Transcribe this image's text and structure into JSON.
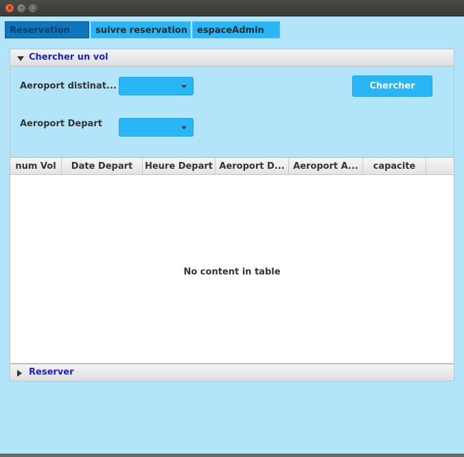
{
  "window": {
    "close_glyph": "×",
    "min_glyph": "–",
    "max_glyph": "□"
  },
  "tabs": [
    {
      "label": "Reservation",
      "active": true
    },
    {
      "label": "suivre reservation",
      "active": false
    },
    {
      "label": "espaceAdmin",
      "active": false
    }
  ],
  "search_pane": {
    "title": "Chercher un vol",
    "expanded": true,
    "destination_label": "Aeroport distinat...",
    "departure_label": "Aeroport Depart",
    "destination_value": "",
    "departure_value": "",
    "search_button": "Chercher"
  },
  "table": {
    "columns": [
      "num Vol",
      "Date Depart",
      "Heure Depart",
      "Aeroport D...",
      "Aeroport A...",
      "capacite"
    ],
    "rows": [],
    "empty_text": "No content in table"
  },
  "reserve_pane": {
    "title": "Reserver",
    "expanded": false
  },
  "colors": {
    "background": "#b3e5fa",
    "accent": "#29b6f6",
    "active_tab": "#0e75bd",
    "pane_title": "#1d1dd6"
  }
}
